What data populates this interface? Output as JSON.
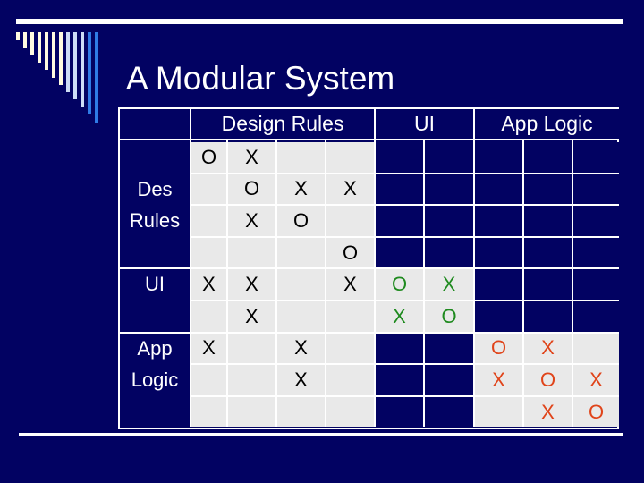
{
  "slide": {
    "title": "A Modular System"
  },
  "decor": {
    "stripe_colors": [
      "#fffbe0",
      "#fffbe0",
      "#fffbe0",
      "#fffbe0",
      "#fffbe0",
      "#fffbe0",
      "#fffbe0",
      "#cddcf6",
      "#cddcf6",
      "#cddcf6",
      "#2f7be6",
      "#2f7be6"
    ]
  },
  "matrix": {
    "column_groups": [
      {
        "label": "Design Rules",
        "span": 4
      },
      {
        "label": "UI",
        "span": 2
      },
      {
        "label": "App Logic",
        "span": 3
      }
    ],
    "row_groups": [
      {
        "label_lines": [
          "Des",
          "Rules"
        ],
        "span": 4,
        "label_row_offset": 1
      },
      {
        "label_lines": [
          "UI"
        ],
        "span": 2,
        "label_row_offset": 0
      },
      {
        "label_lines": [
          "App",
          "Logic"
        ],
        "span": 3,
        "label_row_offset": 0
      }
    ],
    "colors": {
      "navy": "#020262",
      "cell": "#e9e9e9",
      "design_rules_mark": "#000000",
      "ui_mark": "#1f8a1f",
      "app_logic_mark": "#e0441a"
    },
    "rows": [
      [
        "O",
        "X",
        "",
        "",
        null,
        null,
        null,
        null,
        null
      ],
      [
        "",
        "O",
        "X",
        "X",
        null,
        null,
        null,
        null,
        null
      ],
      [
        "",
        "X",
        "O",
        "",
        null,
        null,
        null,
        null,
        null
      ],
      [
        "",
        "",
        "",
        "O",
        null,
        null,
        null,
        null,
        null
      ],
      [
        "X",
        "X",
        "",
        "X",
        "O",
        "X",
        null,
        null,
        null
      ],
      [
        "",
        "X",
        "",
        "",
        "X",
        "O",
        null,
        null,
        null
      ],
      [
        "X",
        "",
        "X",
        "",
        null,
        null,
        "O",
        "X",
        ""
      ],
      [
        "",
        "",
        "X",
        "",
        null,
        null,
        "X",
        "O",
        "X"
      ],
      [
        "",
        "",
        "",
        "",
        null,
        null,
        "",
        "X",
        "O"
      ]
    ],
    "mark_color_by_block": [
      [
        "design_rules_mark",
        "design_rules_mark",
        "design_rules_mark",
        "design_rules_mark",
        "ui_mark",
        "ui_mark",
        "app_logic_mark",
        "app_logic_mark",
        "app_logic_mark"
      ]
    ]
  }
}
